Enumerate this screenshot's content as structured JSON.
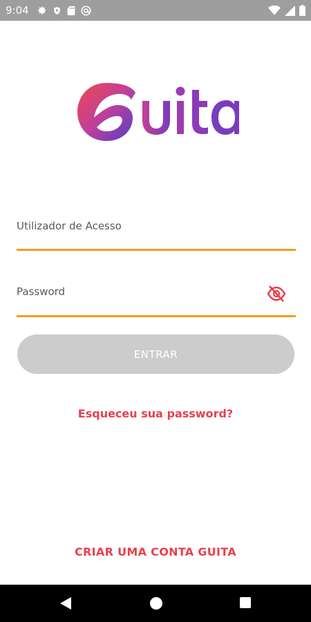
{
  "status_bar": {
    "time": "9:04",
    "left_icons": [
      "settings-icon",
      "shield-icon",
      "sd-card-icon",
      "at-sign-icon"
    ],
    "right_icons": [
      "wifi-icon",
      "signal-icon",
      "battery-icon"
    ]
  },
  "logo": {
    "text": "Guita",
    "gradient_start": "#e83e5a",
    "gradient_mid": "#b042a0",
    "gradient_end": "#5b3fc4"
  },
  "login_form": {
    "username_label": "Utilizador de Acesso",
    "password_label": "Password",
    "password_visibility_icon": "eye-off-icon",
    "submit_label": "ENTRAR",
    "forgot_password": "Esqueceu sua password?"
  },
  "footer": {
    "create_account": "CRIAR UMA CONTA GUITA"
  },
  "nav_bar": {
    "buttons": [
      "back-icon",
      "home-icon",
      "recents-icon"
    ]
  },
  "colors": {
    "accent_underline": "#f39d21",
    "link": "#e8404d",
    "button_disabled": "#cccccc",
    "status_bar": "#9e9e9e"
  }
}
